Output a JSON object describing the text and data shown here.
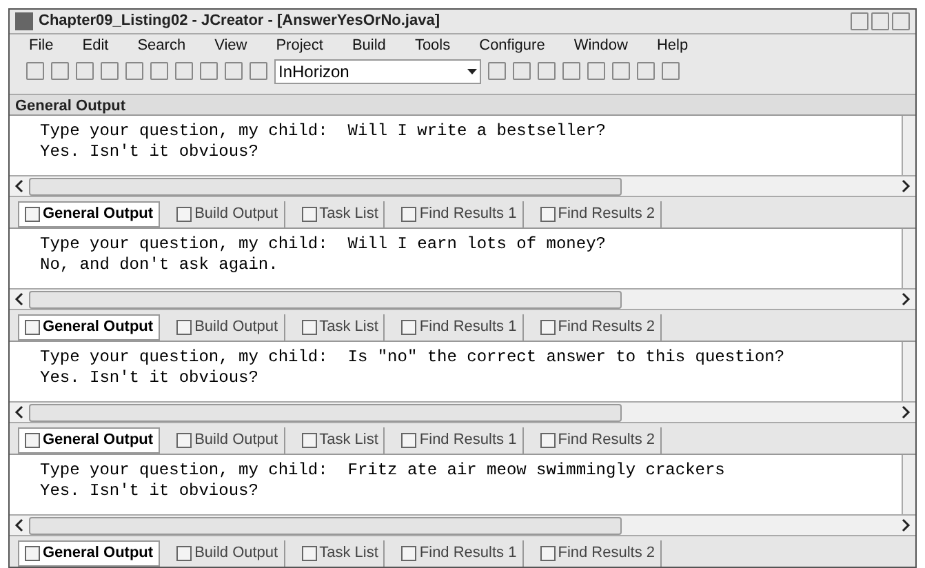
{
  "window": {
    "title": "Chapter09_Listing02 - JCreator - [AnswerYesOrNo.java]"
  },
  "menu": [
    "File",
    "Edit",
    "Search",
    "View",
    "Project",
    "Build",
    "Tools",
    "Configure",
    "Window",
    "Help"
  ],
  "toolbar": {
    "search_value": "InHorizon"
  },
  "panel": {
    "title": "General Output"
  },
  "outputs": [
    {
      "lines": [
        "Type your question, my child:  Will I write a bestseller?",
        "Yes. Isn't it obvious?"
      ],
      "tabs": [
        {
          "label": "General Output",
          "selected": true
        },
        {
          "label": "Build Output",
          "selected": false
        },
        {
          "label": "Task List",
          "selected": false
        },
        {
          "label": "Find Results 1",
          "selected": false
        },
        {
          "label": "Find Results 2",
          "selected": false
        }
      ]
    },
    {
      "lines": [
        "Type your question, my child:  Will I earn lots of money?",
        "No, and don't ask again."
      ],
      "tabs": [
        {
          "label": "General Output",
          "selected": true
        },
        {
          "label": "Build Output",
          "selected": false
        },
        {
          "label": "Task List",
          "selected": false
        },
        {
          "label": "Find Results 1",
          "selected": false
        },
        {
          "label": "Find Results 2",
          "selected": false
        }
      ]
    },
    {
      "lines": [
        "Type your question, my child:  Is \"no\" the correct answer to this question?",
        "Yes. Isn't it obvious?"
      ],
      "tabs": [
        {
          "label": "General Output",
          "selected": true
        },
        {
          "label": "Build Output",
          "selected": false
        },
        {
          "label": "Task List",
          "selected": false
        },
        {
          "label": "Find Results 1",
          "selected": false
        },
        {
          "label": "Find Results 2",
          "selected": false
        }
      ]
    },
    {
      "lines": [
        "Type your question, my child:  Fritz ate air meow swimmingly crackers",
        "Yes. Isn't it obvious?"
      ],
      "tabs": [
        {
          "label": "General Output",
          "selected": true
        },
        {
          "label": "Build Output",
          "selected": false
        },
        {
          "label": "Task List",
          "selected": false
        },
        {
          "label": "Find Results 1",
          "selected": false
        },
        {
          "label": "Find Results 2",
          "selected": false
        }
      ]
    }
  ]
}
